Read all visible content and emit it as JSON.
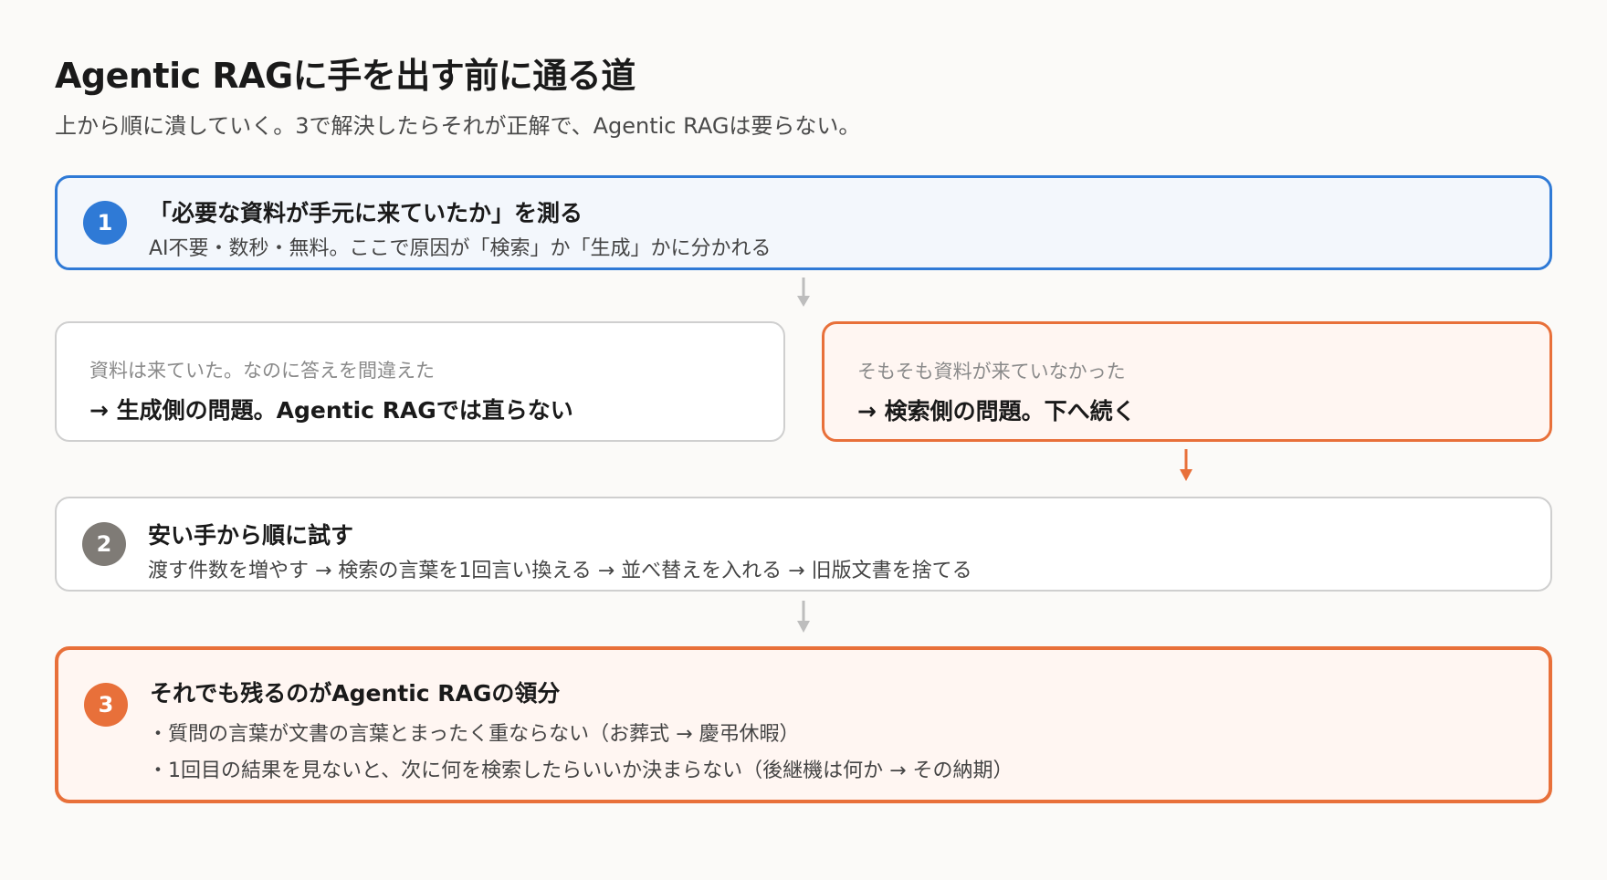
{
  "header": {
    "title": "Agentic RAGに手を出す前に通る道",
    "subtitle": "上から順に潰していく。3で解決したらそれが正解で、Agentic RAGは要らない。"
  },
  "steps": [
    {
      "number": "1",
      "title": "「必要な資料が手元に来ていたか」を測る",
      "description": "AI不要・数秒・無料。ここで原因が「検索」か「生成」かに分かれる"
    },
    {
      "number": "2",
      "title": "安い手から順に試す",
      "description": "渡す件数を増やす → 検索の言葉を1回言い換える → 並べ替えを入れる → 旧版文書を捨てる"
    },
    {
      "number": "3",
      "title": "それでも残るのがAgentic RAGの領分",
      "bullets": [
        "・質問の言葉が文書の言葉とまったく重ならない（お葬式 → 慶弔休暇）",
        "・1回目の結果を見ないと、次に何を検索したらいいか決まらない（後継機は何か → その納期）"
      ]
    }
  ],
  "branches": {
    "left": {
      "label": "資料は来ていた。なのに答えを間違えた",
      "result": "→ 生成側の問題。Agentic RAGでは直らない"
    },
    "right": {
      "label": "そもそも資料が来ていなかった",
      "result": "→ 検索側の問題。下へ続く"
    }
  },
  "colors": {
    "blue": "#2f7ad6",
    "orange": "#e8703a",
    "gray_badge": "#7f7b76",
    "gray_arrow": "#bdbdbd",
    "border_gray": "#cfcfcf"
  },
  "icons": {
    "connector_down": "arrow-down-icon"
  }
}
